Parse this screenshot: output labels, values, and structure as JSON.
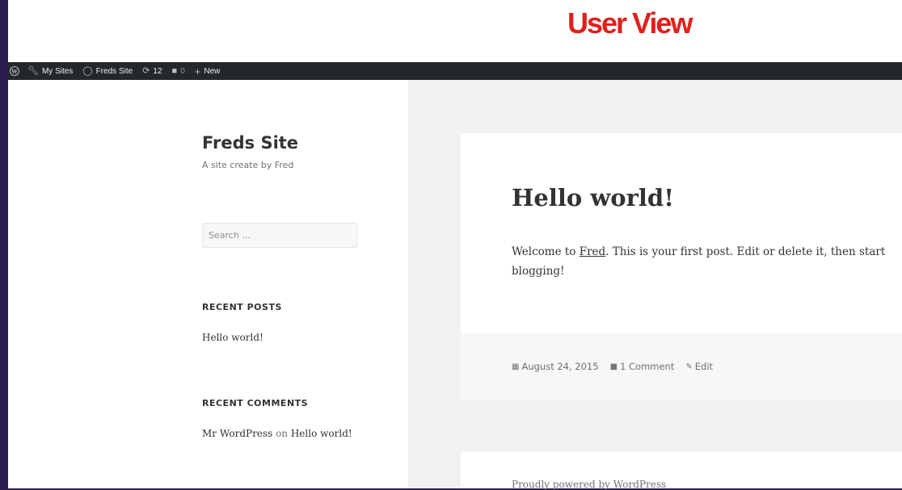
{
  "banner": {
    "title": "User View"
  },
  "admin_bar": {
    "wp_logo": "wordpress-logo",
    "my_sites": "My Sites",
    "site": "Freds Site",
    "updates_count": "12",
    "comments_count": "0",
    "new_label": "New"
  },
  "sidebar": {
    "site_title": "Freds Site",
    "site_description": "A site create by Fred",
    "search_placeholder": "Search …",
    "recent_posts": {
      "heading": "RECENT POSTS",
      "items": [
        "Hello world!"
      ]
    },
    "recent_comments": {
      "heading": "RECENT COMMENTS",
      "author": "Mr WordPress",
      "on": "on",
      "post": "Hello world!"
    }
  },
  "post": {
    "title": "Hello world!",
    "body_before": "Welcome to ",
    "body_link": "Fred",
    "body_line1_after": ". This is your first post. Edit or delete it, then start",
    "body_line2": "blogging!",
    "date": "August 24, 2015",
    "comments": "1 Comment",
    "edit": "Edit"
  },
  "footer": {
    "text": "Proudly powered by WordPress"
  },
  "colors": {
    "banner_title": "#e0201b",
    "admin_bar": "#23282d",
    "outer_frame": "#2b1d4f",
    "content_bg": "#f1f1f1"
  }
}
